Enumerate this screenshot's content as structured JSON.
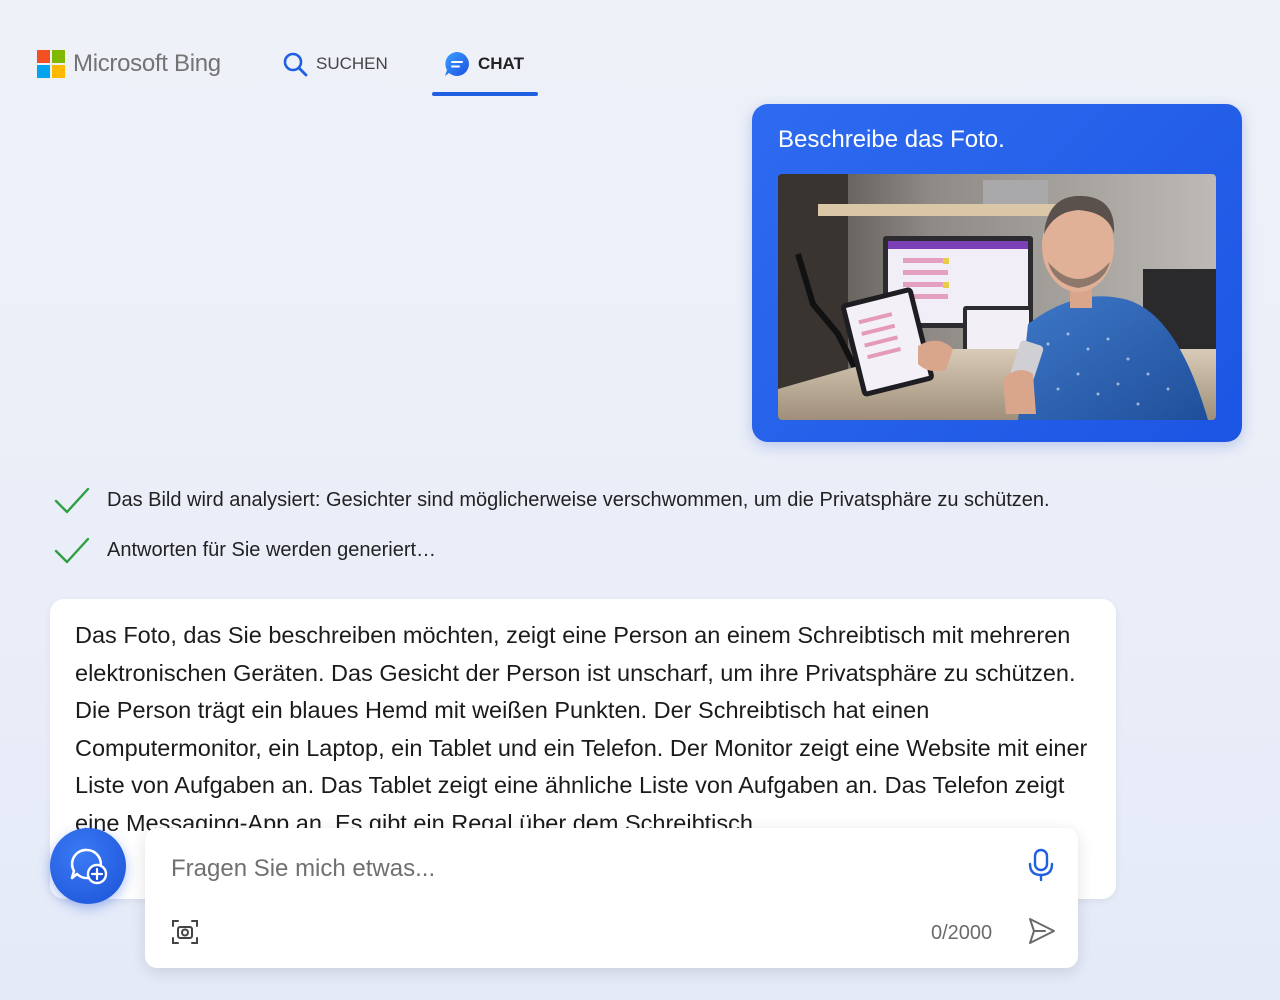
{
  "brand": {
    "name": "Microsoft Bing"
  },
  "nav": {
    "search_label": "SUCHEN",
    "chat_label": "CHAT",
    "active_tab": "chat"
  },
  "colors": {
    "accent": "#1f5fe0",
    "check": "#2ea043",
    "bubble": "#2563eb"
  },
  "conversation": {
    "user_message": "Beschreibe das Foto.",
    "status": [
      "Das Bild wird analysiert: Gesichter sind möglicherweise verschwommen, um die Privatsphäre zu schützen.",
      "Antworten für Sie werden generiert…"
    ],
    "answer": "Das Foto, das Sie beschreiben möchten, zeigt eine Person an einem Schreibtisch mit mehreren elektronischen Geräten. Das Gesicht der Person ist unscharf, um ihre Privatsphäre zu schützen. Die Person trägt ein blaues Hemd mit weißen Punkten. Der Schreibtisch hat einen Computermonitor, ein Laptop, ein Tablet und ein Telefon. Der Monitor zeigt eine Website mit einer Liste von Aufgaben an. Das Tablet zeigt eine ähnliche Liste von Aufgaben an. Das Telefon zeigt eine Messaging-App an. Es gibt ein Regal über dem Schreibtisch"
  },
  "composer": {
    "placeholder": "Fragen Sie mich etwas...",
    "counter": "0/2000"
  },
  "icons": {
    "search": "search-icon",
    "chat": "chat-icon",
    "check": "check-icon",
    "new_topic": "new-topic-icon",
    "mic": "microphone-icon",
    "scan": "image-scan-icon",
    "send": "send-icon"
  }
}
